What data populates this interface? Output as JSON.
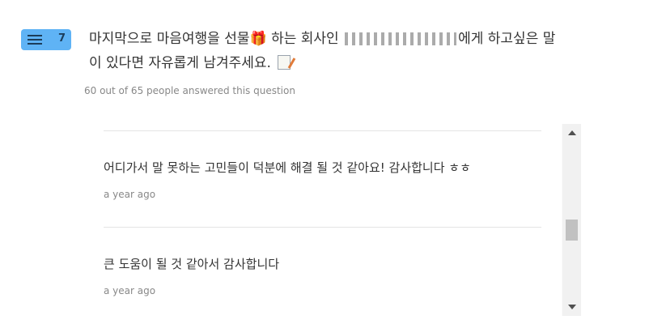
{
  "question": {
    "number": "7",
    "icon": "list-filter-icon",
    "line1_before": "마지막으로 마음여행을 선물",
    "gift_emoji": "🎁",
    "line1_middle": "하는 회사인",
    "line1_after": "에게 하고싶은 말",
    "line2": "이 있다면 자유롭게 남겨주세요.",
    "memo_icon": "memo-icon",
    "meta": "60 out of 65 people answered this question"
  },
  "answers": [
    {
      "text": "어디가서 말 못하는 고민들이 덕분에 해결 될 것 같아요! 감사합니다 ㅎㅎ",
      "time": "a year ago"
    },
    {
      "text": "큰 도움이 될 것 같아서 감사합니다",
      "time": "a year ago"
    }
  ],
  "colors": {
    "badge": "#5fb3f5",
    "text": "#333333",
    "muted": "#888888"
  }
}
